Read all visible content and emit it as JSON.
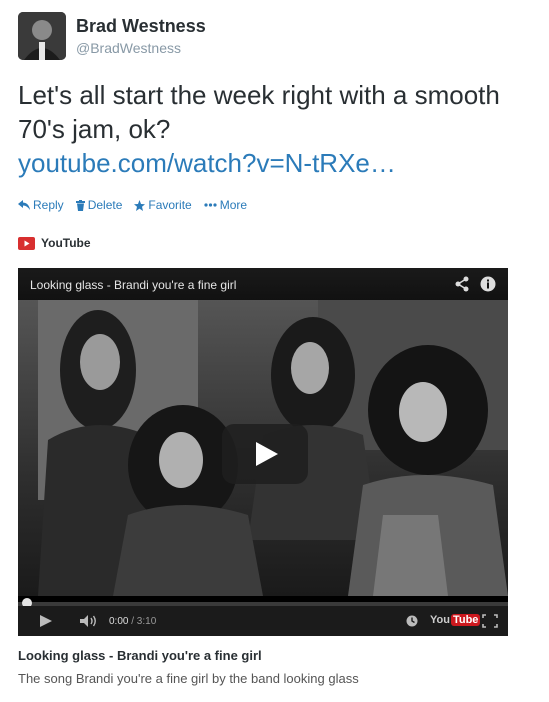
{
  "author": {
    "name": "Brad Westness",
    "handle": "@BradWestness"
  },
  "tweet": {
    "text": "Let's all start the week right with a smooth 70's jam, ok?",
    "link": "youtube.com/watch?v=N-tRXe…"
  },
  "actions": {
    "reply": "Reply",
    "delete": "Delete",
    "favorite": "Favorite",
    "more": "More"
  },
  "card": {
    "source": "YouTube",
    "title": "Looking glass - Brandi you're a fine girl",
    "description": "The song Brandi you're a fine girl by the band looking glass"
  },
  "player": {
    "title": "Looking glass - Brandi you're a fine girl",
    "current_time": "0:00",
    "total_time": "/ 3:10",
    "progress": 0,
    "logo_you": "You",
    "logo_tube": "Tube"
  },
  "colors": {
    "link": "#2b7bb9",
    "youtube_red": "#d82f2f",
    "player_bg": "#000000"
  }
}
